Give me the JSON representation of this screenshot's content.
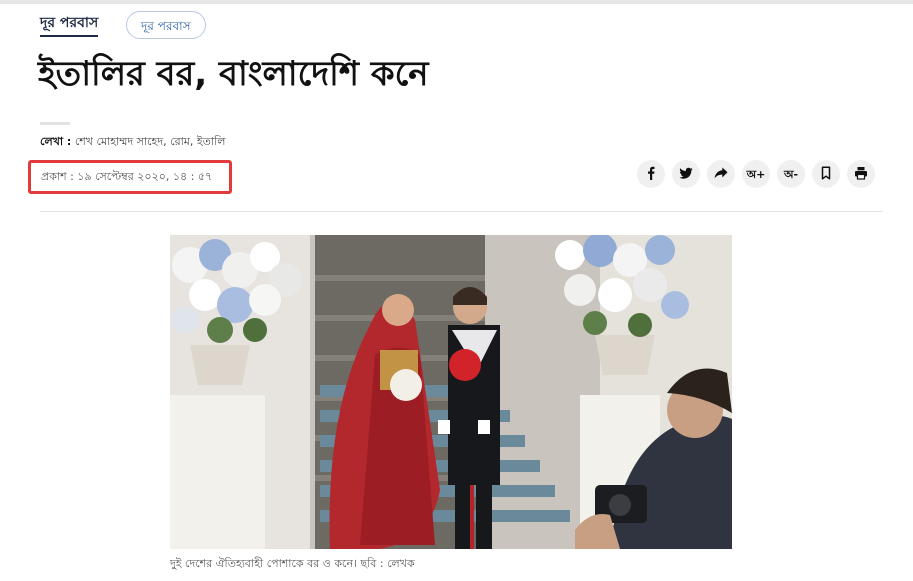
{
  "section": {
    "label": "দূর পরবাস",
    "tag": "দূর পরবাস"
  },
  "article": {
    "headline": "ইতালির বর, বাংলাদেশি কনে",
    "byline_label": "লেখা :",
    "byline_author": "শেখ মোহাম্মদ সাহেদ, রোম, ইতালি",
    "published": "প্রকাশ : ১৯ সেপ্টেম্বর ২০২০, ১৪ : ৫৭",
    "caption": "দুই দেশের ঐতিহ্যবাহী পোশাকে বর ও কনে। ছবি : লেখক"
  },
  "share": {
    "buttons": [
      {
        "icon": "facebook-icon"
      },
      {
        "icon": "twitter-icon"
      },
      {
        "icon": "share-icon"
      },
      {
        "icon": "font-increase-icon",
        "label": "অ+"
      },
      {
        "icon": "font-decrease-icon",
        "label": "অ-"
      },
      {
        "icon": "bookmark-icon"
      },
      {
        "icon": "print-icon"
      }
    ]
  },
  "colors": {
    "highlight_box": "#e23b3b",
    "section_text": "#1f2a44",
    "tag_text": "#2b5ea8"
  }
}
